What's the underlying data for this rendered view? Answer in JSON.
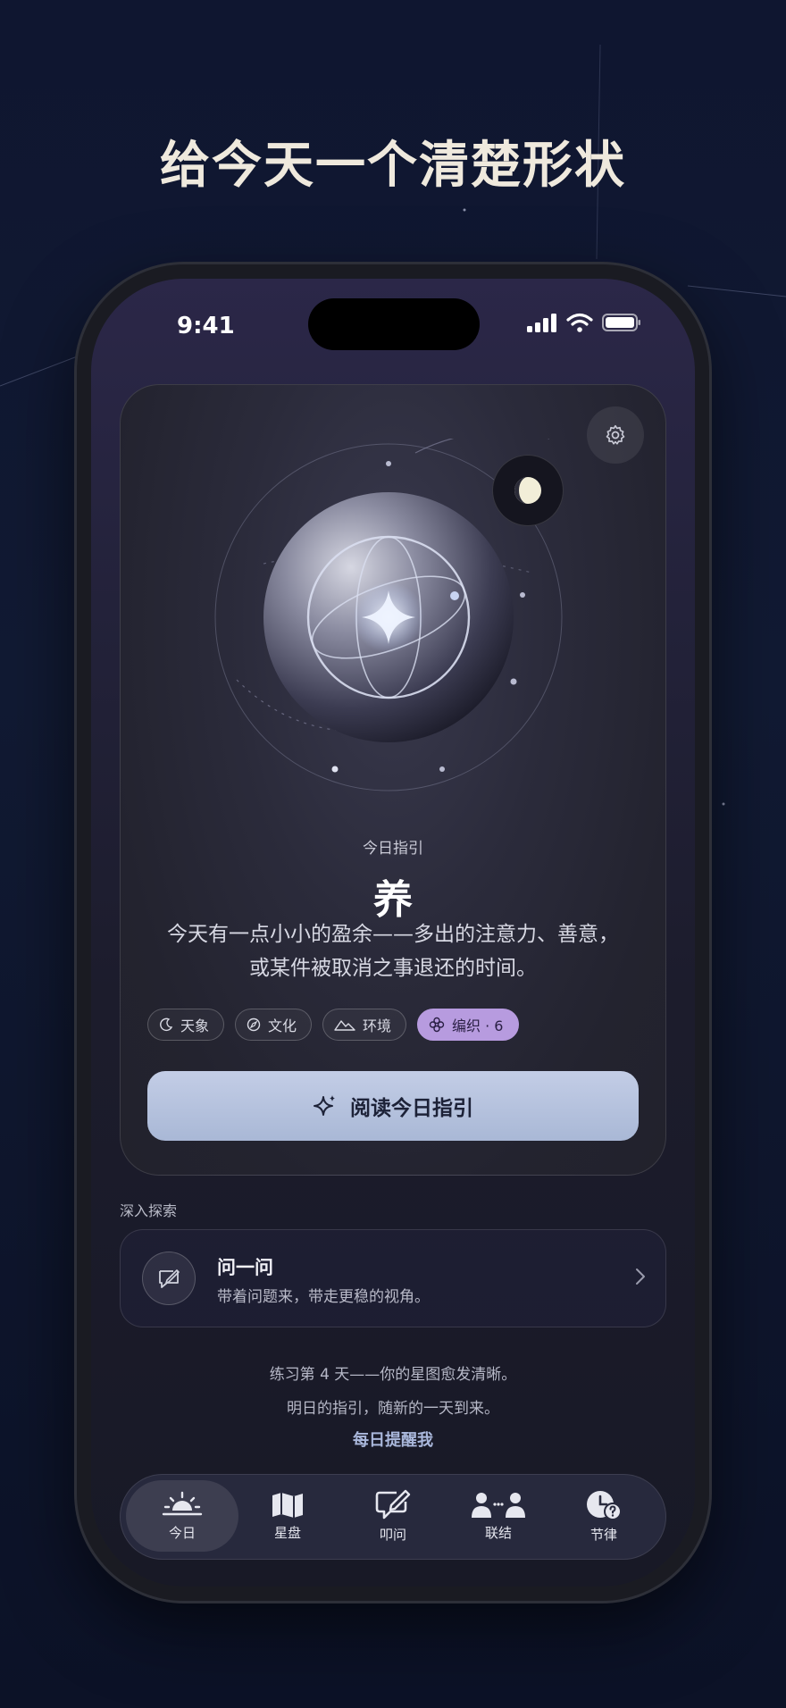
{
  "headline": "给今天一个清楚形状",
  "status_bar": {
    "time": "9:41"
  },
  "guide": {
    "label": "今日指引",
    "title": "养",
    "description_line1": "今天有一点小小的盈余——多出的注意力、善意，",
    "description_line2": "或某件被取消之事退还的时间。"
  },
  "tags": [
    {
      "label": "天象",
      "icon": "moon-crescent-icon"
    },
    {
      "label": "文化",
      "icon": "compass-icon"
    },
    {
      "label": "环境",
      "icon": "mountains-icon"
    },
    {
      "label": "编织 · 6",
      "icon": "flower-icon",
      "active": true
    }
  ],
  "read_button": {
    "label": "阅读今日指引",
    "icon": "sparkle-icon"
  },
  "explore": {
    "section_label": "深入探索",
    "ask": {
      "title": "问一问",
      "subtitle": "带着问题来，带走更稳的视角。"
    }
  },
  "footer": {
    "streak": "练习第 4 天——你的星图愈发清晰。",
    "next": "明日的指引，随新的一天到来。",
    "remind": "每日提醒我"
  },
  "tabs": [
    {
      "label": "今日",
      "icon": "sunrise-icon",
      "active": true
    },
    {
      "label": "星盘",
      "icon": "map-icon"
    },
    {
      "label": "叩问",
      "icon": "message-pen-icon"
    },
    {
      "label": "联结",
      "icon": "people-icon"
    },
    {
      "label": "节律",
      "icon": "clock-question-icon"
    }
  ],
  "colors": {
    "background": "#0f1630",
    "accent_purple": "#b79bdf",
    "button_blue": "#b6c3e0",
    "remind_text": "#aab8dc"
  }
}
